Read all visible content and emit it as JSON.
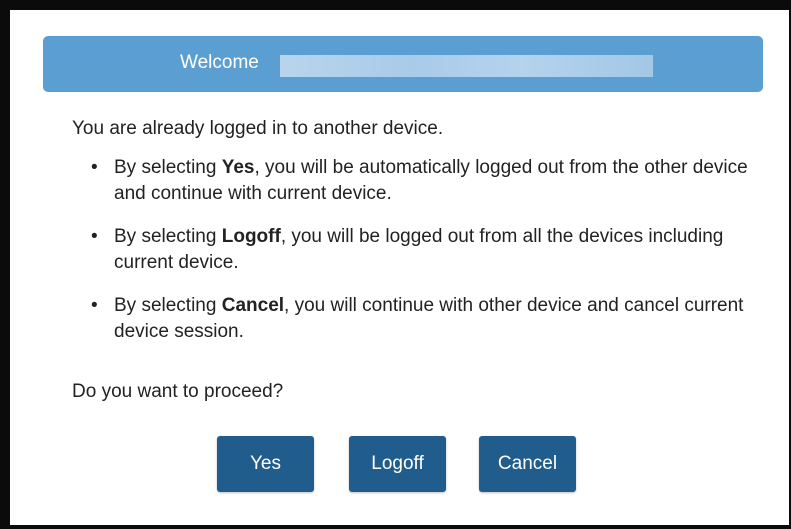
{
  "dialog": {
    "title": "Welcome",
    "intro": "You are already logged in to another device.",
    "options": [
      {
        "prefix": "By selecting ",
        "keyword": "Yes",
        "text": ", you will be automatically logged out from the other device and continue with current device."
      },
      {
        "prefix": "By selecting ",
        "keyword": "Logoff",
        "text": ", you will be logged out from all the devices including current device."
      },
      {
        "prefix": "By selecting ",
        "keyword": "Cancel",
        "text": ", you will continue with other device and cancel current device session."
      }
    ],
    "question": "Do you want to proceed?",
    "buttons": {
      "yes": "Yes",
      "logoff": "Logoff",
      "cancel": "Cancel"
    }
  },
  "colors": {
    "header": "#5b9fd2",
    "button": "#215d8c",
    "frame": "#0b0b0b"
  }
}
